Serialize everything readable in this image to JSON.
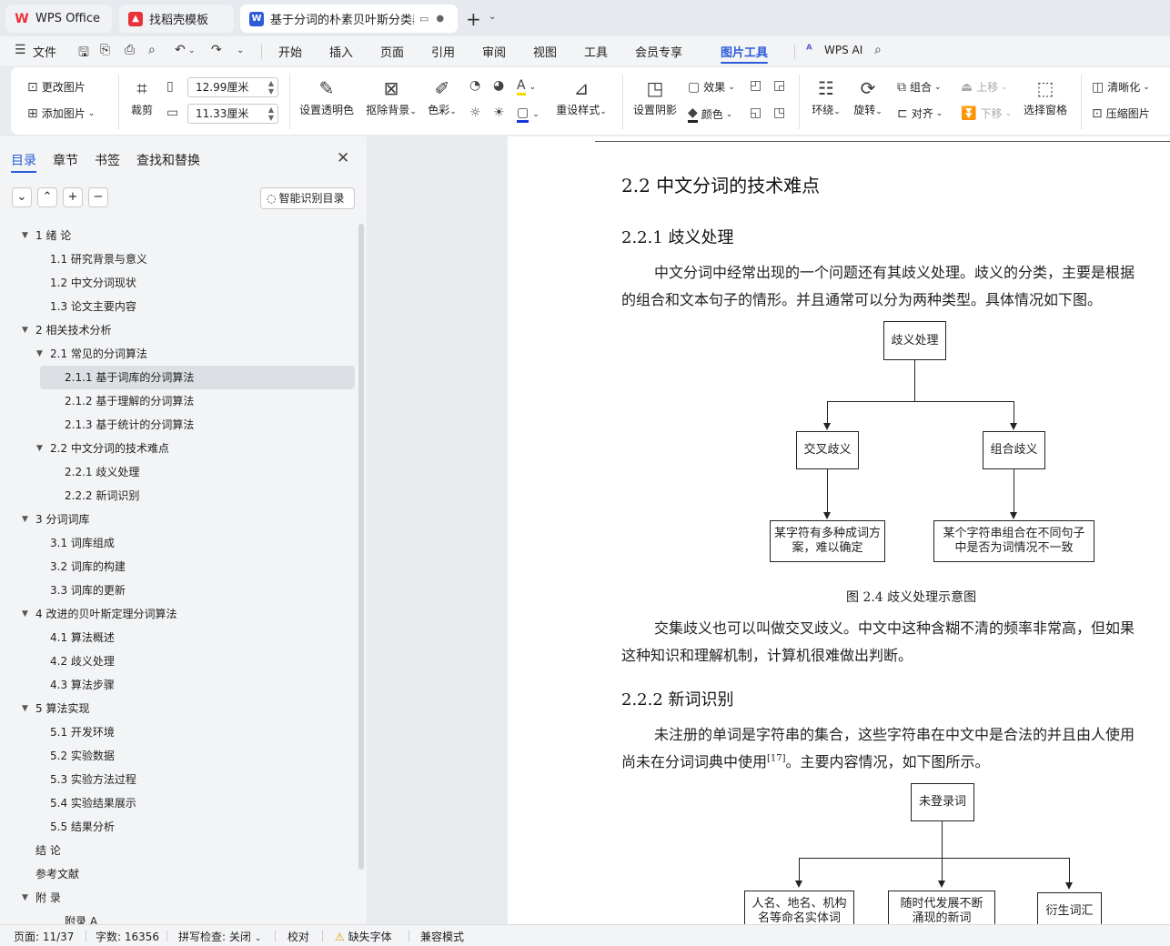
{
  "tabs": [
    {
      "label": "WPS Office",
      "icon": "wps-logo-icon"
    },
    {
      "label": "找稻壳模板",
      "icon": "docer-icon"
    },
    {
      "label": "基于分词的朴素贝叶斯分类器",
      "icon": "writer-doc-icon",
      "active": true
    }
  ],
  "menu": {
    "file": "文件",
    "items": [
      "开始",
      "插入",
      "页面",
      "引用",
      "审阅",
      "视图",
      "工具",
      "会员专享",
      "图片工具"
    ],
    "active": "图片工具",
    "wps_ai": "WPS AI"
  },
  "ribbon": {
    "change_picture": "更改图片",
    "add_picture": "添加图片",
    "crop": "裁剪",
    "width_value": "12.99厘米",
    "height_value": "11.33厘米",
    "set_transparent": "设置透明色",
    "remove_bg": "抠除背景",
    "color": "色彩",
    "reset_style": "重设样式",
    "shadow": "设置阴影",
    "effect": "效果",
    "fill_color": "颜色",
    "wrap": "环绕",
    "rotate": "旋转",
    "group": "组合",
    "align": "对齐",
    "bring_forward": "上移",
    "send_backward": "下移",
    "selection_pane": "选择窗格",
    "sharpen": "清晰化",
    "compress": "压缩图片"
  },
  "nav": {
    "tabs": [
      "目录",
      "章节",
      "书签",
      "查找和替换"
    ],
    "smart_toc": "智能识别目录",
    "toc": [
      {
        "label": "1  绪  论",
        "level": 1,
        "expanded": true
      },
      {
        "label": "1.1 研究背景与意义",
        "level": 2
      },
      {
        "label": "1.2 中文分词现状",
        "level": 2
      },
      {
        "label": "1.3  论文主要内容",
        "level": 2
      },
      {
        "label": "2 相关技术分析",
        "level": 1,
        "expanded": true
      },
      {
        "label": "2.1 常见的分词算法",
        "level": 2,
        "expanded": true
      },
      {
        "label": "2.1.1 基于词库的分词算法",
        "level": 3,
        "selected": true
      },
      {
        "label": "2.1.2 基于理解的分词算法",
        "level": 3
      },
      {
        "label": "2.1.3 基于统计的分词算法",
        "level": 3
      },
      {
        "label": "2.2 中文分词的技术难点",
        "level": 2,
        "expanded": true
      },
      {
        "label": "2.2.1 歧义处理",
        "level": 3
      },
      {
        "label": "2.2.2 新词识别",
        "level": 3
      },
      {
        "label": "3 分词词库",
        "level": 1,
        "expanded": true
      },
      {
        "label": "3.1 词库组成",
        "level": 2
      },
      {
        "label": "3.2  词库的构建",
        "level": 2
      },
      {
        "label": "3.3  词库的更新",
        "level": 2
      },
      {
        "label": "4  改进的贝叶斯定理分词算法",
        "level": 1,
        "expanded": true
      },
      {
        "label": "4.1  算法概述",
        "level": 2
      },
      {
        "label": "4.2  歧义处理",
        "level": 2
      },
      {
        "label": "4.3  算法步骤",
        "level": 2
      },
      {
        "label": "5  算法实现",
        "level": 1,
        "expanded": true
      },
      {
        "label": "5.1  开发环境",
        "level": 2
      },
      {
        "label": "5.2  实验数据",
        "level": 2
      },
      {
        "label": "5.3  实验方法过程",
        "level": 2
      },
      {
        "label": "5.4  实验结果展示",
        "level": 2
      },
      {
        "label": "5.5 结果分析",
        "level": 2
      },
      {
        "label": "结  论",
        "level": 1
      },
      {
        "label": "参考文献",
        "level": 1
      },
      {
        "label": "附  录",
        "level": 1,
        "expanded": true
      },
      {
        "label": "附录 A",
        "level": 3
      }
    ]
  },
  "doc": {
    "h2": "2.2 中文分词的技术难点",
    "h3a": "2.2.1 歧义处理",
    "p1a": "中文分词中经常出现的一个问题还有其歧义处理。歧义的分类，主要是根据",
    "p1b": "的组合和文本句子的情形。并且通常可以分为两种类型。具体情况如下图。",
    "fig1": {
      "root": "歧义处理",
      "left": "交叉歧义",
      "right": "组合歧义",
      "left_leaf_1": "某字符有多种成词方",
      "left_leaf_2": "案，难以确定",
      "right_leaf_1": "某个字符串组合在不同句子",
      "right_leaf_2": "中是否为词情况不一致"
    },
    "caption1": "图 2.4 歧义处理示意图",
    "p2a": "交集歧义也可以叫做交叉歧义。中文中这种含糊不清的频率非常高，但如果",
    "p2b": "这种知识和理解机制，计算机很难做出判断。",
    "h3b": "2.2.2 新词识别",
    "p3a": "未注册的单词是字符串的集合，这些字符串在中文中是合法的并且由人使用",
    "p3b_pre": "尚未在分词词典中使用",
    "p3b_sup": "[17]",
    "p3b_post": "。主要内容情况，如下图所示。",
    "fig2": {
      "root": "未登录词",
      "a1": "人名、地名、机构",
      "a2": "名等命名实体词",
      "b1": "随时代发展不断",
      "b2": "涌现的新词",
      "c": "衍生词汇"
    }
  },
  "status": {
    "page": "页面: 11/37",
    "words": "字数: 16356",
    "spell": "拼写检查: 关闭",
    "proof": "校对",
    "missing_font": "缺失字体",
    "compat": "兼容模式"
  }
}
